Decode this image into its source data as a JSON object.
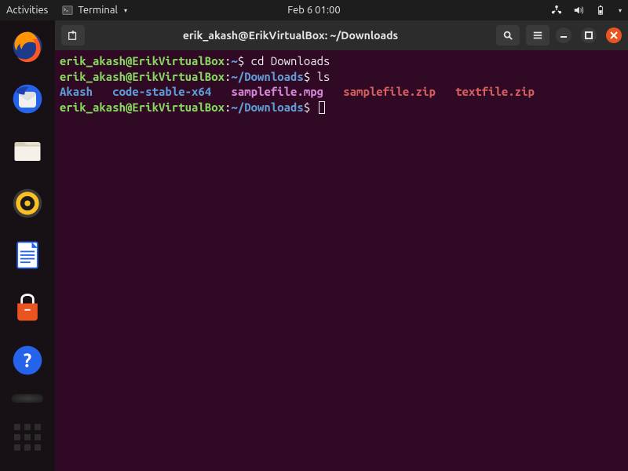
{
  "top_panel": {
    "activities": "Activities",
    "app_name": "Terminal",
    "clock": "Feb 6  01:00"
  },
  "dock": {
    "items": [
      "firefox",
      "thunderbird",
      "files",
      "rhythmbox",
      "libreoffice-writer",
      "software-center",
      "help"
    ]
  },
  "window": {
    "title": "erik_akash@ErikVirtualBox: ~/Downloads"
  },
  "terminal": {
    "lines": [
      {
        "prompt": {
          "user_host": "erik_akash@ErikVirtualBox",
          "path": "~"
        },
        "command": "cd Downloads"
      },
      {
        "prompt": {
          "user_host": "erik_akash@ErikVirtualBox",
          "path": "~/Downloads"
        },
        "command": "ls"
      }
    ],
    "ls_output": [
      {
        "name": "Akash",
        "type": "dir"
      },
      {
        "name": "code-stable-x64",
        "type": "dir"
      },
      {
        "name": "samplefile.mpg",
        "type": "media"
      },
      {
        "name": "samplefile.zip",
        "type": "archive"
      },
      {
        "name": "textfile.zip",
        "type": "archive"
      }
    ],
    "current_prompt": {
      "user_host": "erik_akash@ErikVirtualBox",
      "path": "~/Downloads"
    }
  }
}
